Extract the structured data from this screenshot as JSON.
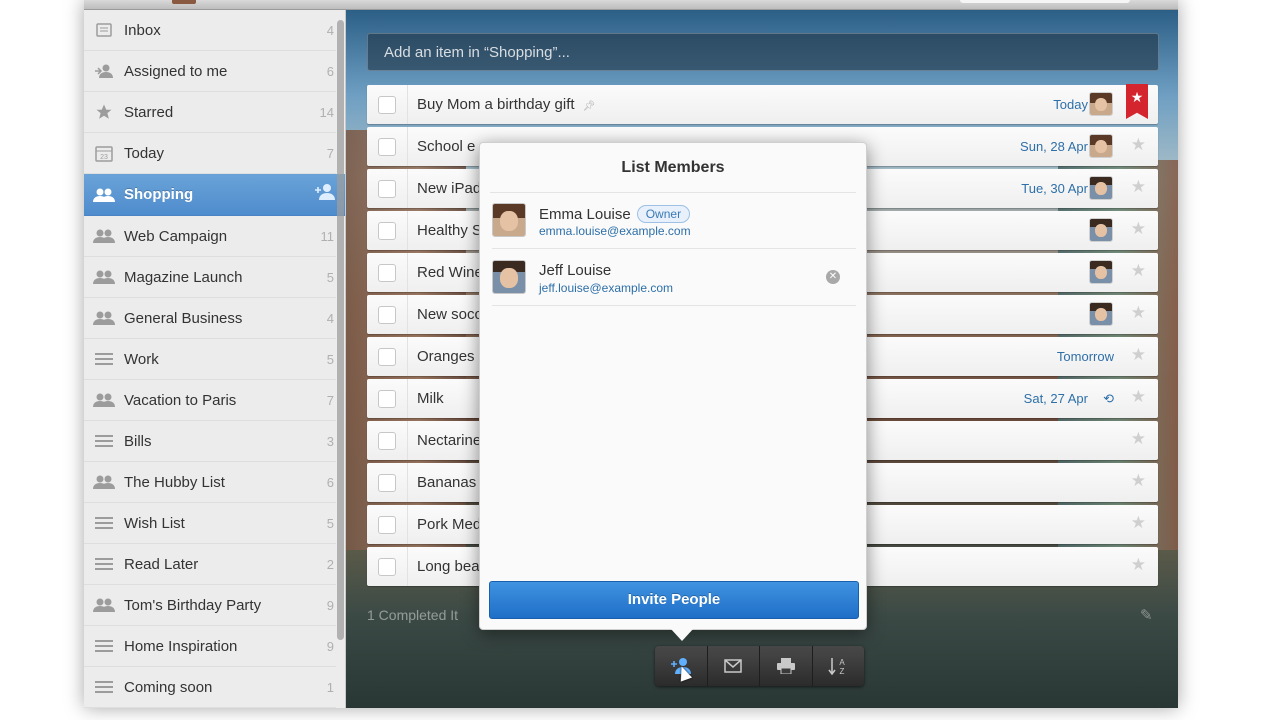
{
  "sidebar": {
    "items": [
      {
        "label": "Inbox",
        "count": "4",
        "icon": "inbox-icon"
      },
      {
        "label": "Assigned to me",
        "count": "6",
        "icon": "assigned-user-icon"
      },
      {
        "label": "Starred",
        "count": "14",
        "icon": "star-icon"
      },
      {
        "label": "Today",
        "count": "7",
        "icon": "calendar-icon"
      },
      {
        "label": "Shopping",
        "count": "",
        "icon": "shared-list-icon"
      },
      {
        "label": "Web Campaign",
        "count": "11",
        "icon": "shared-list-icon"
      },
      {
        "label": "Magazine Launch",
        "count": "5",
        "icon": "shared-list-icon"
      },
      {
        "label": "General Business",
        "count": "4",
        "icon": "shared-list-icon"
      },
      {
        "label": "Work",
        "count": "5",
        "icon": "list-icon"
      },
      {
        "label": "Vacation to Paris",
        "count": "7",
        "icon": "shared-list-icon"
      },
      {
        "label": "Bills",
        "count": "3",
        "icon": "list-icon"
      },
      {
        "label": "The Hubby List",
        "count": "6",
        "icon": "shared-list-icon"
      },
      {
        "label": "Wish List",
        "count": "5",
        "icon": "list-icon"
      },
      {
        "label": "Read Later",
        "count": "2",
        "icon": "list-icon"
      },
      {
        "label": "Tom's Birthday Party",
        "count": "9",
        "icon": "shared-list-icon"
      },
      {
        "label": "Home Inspiration",
        "count": "9",
        "icon": "list-icon"
      },
      {
        "label": "Coming soon",
        "count": "1",
        "icon": "list-icon"
      }
    ],
    "active_index": 4,
    "active_add_member_icon": "add-member-icon"
  },
  "main": {
    "add_placeholder": "Add an item in “Shopping”...",
    "tasks": [
      {
        "title": "Buy Mom a birthday gift",
        "date": "Today",
        "starred": true,
        "pinned": true
      },
      {
        "title": "School e",
        "date": "Sun, 28 Apr",
        "starred": false
      },
      {
        "title": "New iPad",
        "date": "Tue, 30 Apr",
        "starred": false
      },
      {
        "title": "Healthy S",
        "date": "",
        "starred": false
      },
      {
        "title": "Red Wine",
        "date": "",
        "starred": false
      },
      {
        "title": "New socc",
        "date": "",
        "starred": false
      },
      {
        "title": "Oranges",
        "date": "Tomorrow",
        "starred": false
      },
      {
        "title": "Milk",
        "date": "Sat, 27 Apr",
        "starred": false,
        "repeat": true
      },
      {
        "title": "Nectarine",
        "date": "",
        "starred": false
      },
      {
        "title": "Bananas",
        "date": "",
        "starred": false
      },
      {
        "title": "Pork Med",
        "date": "",
        "starred": false
      },
      {
        "title": "Long bea",
        "date": "",
        "starred": false
      }
    ],
    "completed_label": "1 Completed It"
  },
  "popover": {
    "title": "List Members",
    "members": [
      {
        "name": "Emma Louise",
        "email": "emma.louise@example.com",
        "badge": "Owner"
      },
      {
        "name": "Jeff Louise",
        "email": "jeff.louise@example.com",
        "badge": ""
      }
    ],
    "invite_label": "Invite People"
  },
  "toolbar": {
    "buttons": [
      "share-members-icon",
      "email-icon",
      "print-icon",
      "sort-icon"
    ]
  },
  "colors": {
    "accent": "#4f8ccd",
    "invite": "#2f80d6",
    "star_flag": "#d4252f",
    "date_text": "#2e6fa8"
  }
}
